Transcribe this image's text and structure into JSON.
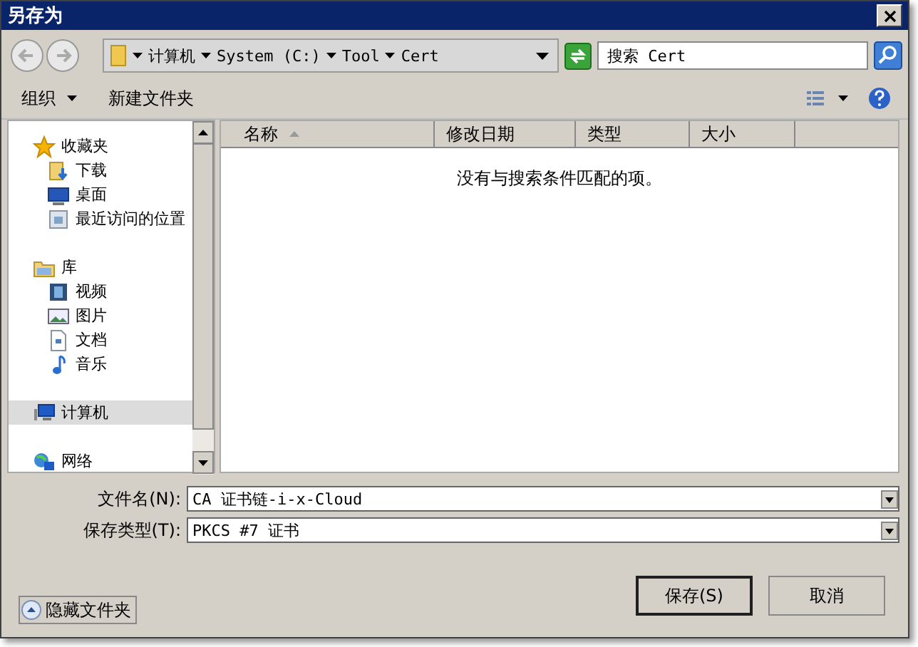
{
  "window": {
    "title": "另存为"
  },
  "address": {
    "path": [
      "计算机",
      "System (C:)",
      "Tool",
      "Cert"
    ]
  },
  "search": {
    "placeholder": "搜索 Cert"
  },
  "toolbar": {
    "organize": "组织",
    "new_folder": "新建文件夹"
  },
  "sidebar": {
    "groups": [
      {
        "label": "收藏夹",
        "kind": "star",
        "selected": false,
        "children": [
          {
            "label": "下载",
            "kind": "download",
            "selected": false
          },
          {
            "label": "桌面",
            "kind": "desktop",
            "selected": false
          },
          {
            "label": "最近访问的位置",
            "kind": "recent",
            "selected": false
          }
        ]
      },
      {
        "label": "库",
        "kind": "library",
        "selected": false,
        "children": [
          {
            "label": "视频",
            "kind": "video",
            "selected": false
          },
          {
            "label": "图片",
            "kind": "pictures",
            "selected": false
          },
          {
            "label": "文档",
            "kind": "document",
            "selected": false
          },
          {
            "label": "音乐",
            "kind": "music",
            "selected": false
          }
        ]
      },
      {
        "label": "计算机",
        "kind": "computer",
        "selected": true
      },
      {
        "label": "网络",
        "kind": "network",
        "selected": false
      }
    ]
  },
  "file_list": {
    "columns": [
      {
        "label": "名称",
        "sorted": true
      },
      {
        "label": "修改日期",
        "sorted": false
      },
      {
        "label": "类型",
        "sorted": false
      },
      {
        "label": "大小",
        "sorted": false
      }
    ],
    "empty_message": "没有与搜索条件匹配的项。"
  },
  "fields": [
    {
      "label": "文件名(N):",
      "value": "CA 证书链-i-x-Cloud"
    },
    {
      "label": "保存类型(T):",
      "value": "PKCS #7 证书"
    }
  ],
  "hide_folders": "隐藏文件夹",
  "buttons": [
    {
      "label": "保存(S)",
      "default": true
    },
    {
      "label": "取消",
      "default": false
    }
  ]
}
